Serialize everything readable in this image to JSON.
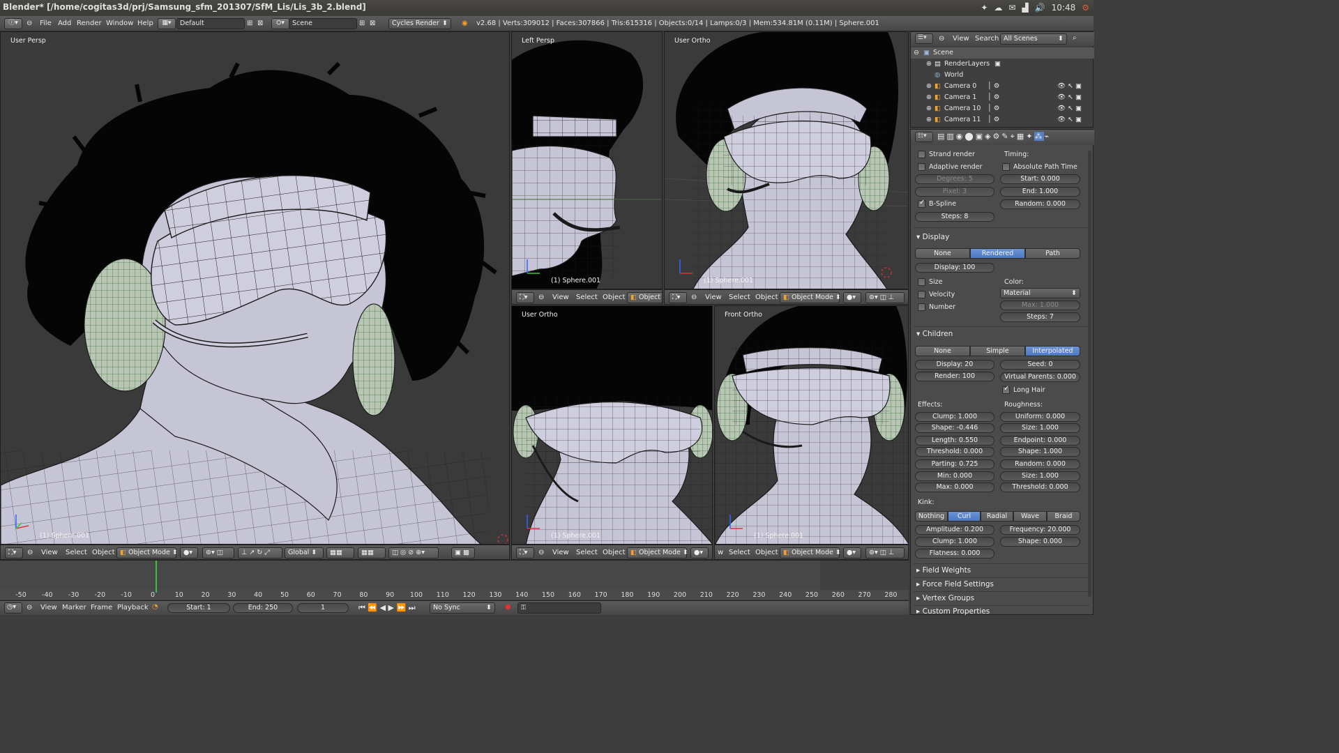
{
  "titlebar": {
    "title": "Blender* [/home/cogitas3d/prj/Samsung_sfm_201307/SfM_Lis/Lis_3b_2.blend]",
    "clock": "10:48"
  },
  "info": {
    "menus": [
      "File",
      "Add",
      "Render",
      "Window",
      "Help"
    ],
    "screen_layout": "Default",
    "scene": "Scene",
    "engine": "Cycles Render",
    "stats": "v2.68 | Verts:309012 | Faces:307866 | Tris:615316 | Objects:0/14 | Lamps:0/3 | Mem:534.81M (0.11M) | Sphere.001"
  },
  "viewports": {
    "main": {
      "label": "User Persp",
      "object": "(1) Sphere.001"
    },
    "left_persp": {
      "label": "Left Persp",
      "object": "(1) Sphere.001"
    },
    "user_ortho_top": {
      "label": "User Ortho",
      "object": "(1) Sphere.001"
    },
    "user_ortho_bottom": {
      "label": "User Ortho",
      "object": "(1) Sphere.001"
    },
    "front_ortho": {
      "label": "Front Ortho",
      "object": "(1) Sphere.001"
    }
  },
  "header_menu": {
    "view": "View",
    "select": "Select",
    "object": "Object",
    "mode": "Object Mode",
    "mode_short": "Object M",
    "orientation": "Global"
  },
  "timeline": {
    "ticks": [
      "-50",
      "-40",
      "-30",
      "-20",
      "-10",
      "0",
      "10",
      "20",
      "30",
      "40",
      "50",
      "60",
      "70",
      "80",
      "90",
      "100",
      "110",
      "120",
      "130",
      "140",
      "150",
      "160",
      "170",
      "180",
      "190",
      "200",
      "210",
      "220",
      "230",
      "240",
      "250",
      "260",
      "270",
      "280"
    ],
    "current_frame": 1,
    "menus": [
      "View",
      "Marker",
      "Frame",
      "Playback"
    ],
    "start": "Start: 1",
    "end": "End: 250",
    "frame": "1",
    "sync": "No Sync"
  },
  "outliner": {
    "view": "View",
    "search": "Search",
    "filter": "All Scenes",
    "items": [
      "Scene",
      "RenderLayers",
      "World",
      "Camera 0",
      "Camera 1",
      "Camera 10",
      "Camera 11"
    ]
  },
  "props": {
    "strand_render": "Strand render",
    "adaptive_render": "Adaptive render",
    "timing": "Timing:",
    "absolute_path_time": "Absolute Path Time",
    "degrees": "Degrees: 5",
    "pixel": "Pixel: 3",
    "start": "Start: 0.000",
    "end": "End: 1.000",
    "bspline": "B-Spline",
    "random": "Random: 0.000",
    "steps": "Steps: 8",
    "display_header": "Display",
    "display_tabs": [
      "None",
      "Rendered",
      "Path"
    ],
    "display_value": "Display: 100",
    "size": "Size",
    "velocity": "Velocity",
    "number": "Number",
    "color_label": "Color:",
    "color_value": "Material",
    "max": "Max: 1.000",
    "display_steps": "Steps: 7",
    "children_header": "Children",
    "children_tabs": [
      "None",
      "Simple",
      "Interpolated"
    ],
    "child_display": "Display: 20",
    "child_render": "Render: 100",
    "seed": "Seed: 0",
    "virtual_parents": "Virtual Parents: 0.000",
    "long_hair": "Long Hair",
    "effects_label": "Effects:",
    "roughness_label": "Roughness:",
    "clump": "Clump: 1.000",
    "shape": "Shape: -0.446",
    "length": "Length: 0.550",
    "threshold": "Threshold: 0.000",
    "parting": "Parting: 0.725",
    "min": "Min: 0.000",
    "pmax": "Max: 0.000",
    "uniform": "Uniform: 0.000",
    "r_size": "Size: 1.000",
    "endpoint": "Endpoint: 0.000",
    "r_shape": "Shape: 1.000",
    "r_random": "Random: 0.000",
    "r_size2": "Size: 1.000",
    "r_threshold": "Threshold: 0.000",
    "kink_label": "Kink:",
    "kink_tabs": [
      "Nothing",
      "Curl",
      "Radial",
      "Wave",
      "Braid"
    ],
    "amplitude": "Amplitude: 0.200",
    "frequency": "Frequency: 20.000",
    "k_clump": "Clump: 1.000",
    "k_shape": "Shape: 0.000",
    "flatness": "Flatness: 0.000",
    "field_weights": "Field Weights",
    "force_field_settings": "Force Field Settings",
    "vertex_groups": "Vertex Groups",
    "custom_properties": "Custom Properties"
  },
  "colors": {
    "accent": "#5680c2",
    "timeline_cursor": "#3fbf3f",
    "hair": "#050505",
    "mesh": "#c6c5d6"
  }
}
